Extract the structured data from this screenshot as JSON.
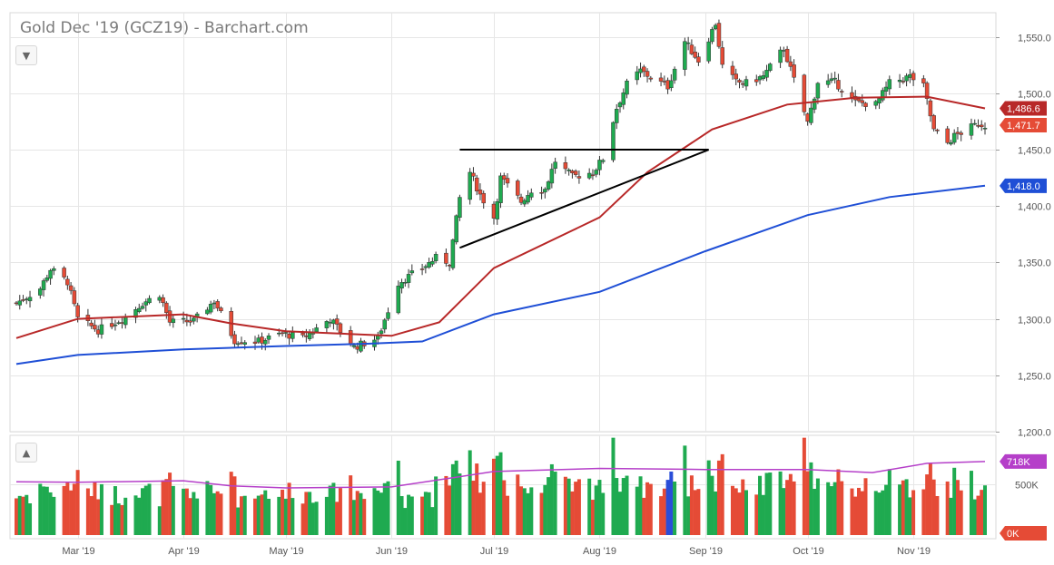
{
  "title": "Gold Dec '19 (GCZ19) - Barchart.com",
  "controls": {
    "collapse_main_icon": "chevron-down-icon",
    "collapse_volume_icon": "chevron-up-icon"
  },
  "colors": {
    "up": "#1faa50",
    "down": "#e54b36",
    "ma_slow": "#1f4fd6",
    "ma_fast": "#b82828",
    "vol_avg": "#b53fc9",
    "vol_special": "#2a4dd8",
    "trendline": "#000000",
    "grid": "#e6e6e6"
  },
  "chart_data": [
    {
      "type": "candlestick",
      "title": "Gold Dec '19 (GCZ19) - Barchart.com",
      "x_tick_labels": [
        "Mar '19",
        "Apr '19",
        "May '19",
        "Jun '19",
        "Jul '19",
        "Aug '19",
        "Sep '19",
        "Oct '19",
        "Nov '19"
      ],
      "y_tick_labels": [
        "1,550.0",
        "1,500.0",
        "1,450.0",
        "1,400.0",
        "1,350.0",
        "1,300.0",
        "1,250.0",
        "1,200.0"
      ],
      "ylim": [
        1200,
        1565
      ],
      "grid": true,
      "price_labels": [
        {
          "text": "1,486.6",
          "value": 1486.6,
          "series": "ma_fast"
        },
        {
          "text": "1,471.7",
          "value": 1471.7,
          "series": "last"
        },
        {
          "text": "1,418.0",
          "value": 1418.0,
          "series": "ma_slow"
        }
      ],
      "anchors": [
        [
          "2019-02-11",
          1314
        ],
        [
          "2019-02-18",
          1327
        ],
        [
          "2019-02-21",
          1344
        ],
        [
          "2019-02-26",
          1333
        ],
        [
          "2019-03-01",
          1300
        ],
        [
          "2019-03-07",
          1290
        ],
        [
          "2019-03-14",
          1300
        ],
        [
          "2019-03-20",
          1314
        ],
        [
          "2019-03-25",
          1322
        ],
        [
          "2019-03-28",
          1297
        ],
        [
          "2019-04-04",
          1298
        ],
        [
          "2019-04-10",
          1316
        ],
        [
          "2019-04-16",
          1281
        ],
        [
          "2019-04-23",
          1280
        ],
        [
          "2019-04-30",
          1287
        ],
        [
          "2019-05-06",
          1283
        ],
        [
          "2019-05-14",
          1300
        ],
        [
          "2019-05-21",
          1275
        ],
        [
          "2019-05-28",
          1283
        ],
        [
          "2019-06-03",
          1332
        ],
        [
          "2019-06-10",
          1345
        ],
        [
          "2019-06-14",
          1354
        ],
        [
          "2019-06-18",
          1350
        ],
        [
          "2019-06-21",
          1407
        ],
        [
          "2019-06-24",
          1430
        ],
        [
          "2019-06-27",
          1410
        ],
        [
          "2019-07-01",
          1390
        ],
        [
          "2019-07-03",
          1425
        ],
        [
          "2019-07-09",
          1404
        ],
        [
          "2019-07-12",
          1414
        ],
        [
          "2019-07-16",
          1415
        ],
        [
          "2019-07-19",
          1440
        ],
        [
          "2019-07-24",
          1426
        ],
        [
          "2019-07-30",
          1430
        ],
        [
          "2019-08-02",
          1442
        ],
        [
          "2019-08-06",
          1487
        ],
        [
          "2019-08-09",
          1508
        ],
        [
          "2019-08-13",
          1520
        ],
        [
          "2019-08-16",
          1514
        ],
        [
          "2019-08-21",
          1506
        ],
        [
          "2019-08-26",
          1546
        ],
        [
          "2019-08-30",
          1529
        ],
        [
          "2019-09-04",
          1562
        ],
        [
          "2019-09-06",
          1524
        ],
        [
          "2019-09-10",
          1510
        ],
        [
          "2019-09-13",
          1509
        ],
        [
          "2019-09-18",
          1515
        ],
        [
          "2019-09-24",
          1540
        ],
        [
          "2019-10-01",
          1474
        ],
        [
          "2019-10-04",
          1510
        ],
        [
          "2019-10-09",
          1510
        ],
        [
          "2019-10-15",
          1492
        ],
        [
          "2019-10-21",
          1490
        ],
        [
          "2019-10-25",
          1509
        ],
        [
          "2019-10-31",
          1515
        ],
        [
          "2019-11-04",
          1506
        ],
        [
          "2019-11-07",
          1467
        ],
        [
          "2019-11-11",
          1456
        ],
        [
          "2019-11-13",
          1462
        ],
        [
          "2019-11-20",
          1473
        ],
        [
          "2019-11-22",
          1471.7
        ]
      ],
      "ma_fast": [
        [
          "2019-02-11",
          1283
        ],
        [
          "2019-03-01",
          1300
        ],
        [
          "2019-04-01",
          1304
        ],
        [
          "2019-04-15",
          1296
        ],
        [
          "2019-05-01",
          1289
        ],
        [
          "2019-06-01",
          1285
        ],
        [
          "2019-06-15",
          1297
        ],
        [
          "2019-07-01",
          1345
        ],
        [
          "2019-08-01",
          1390
        ],
        [
          "2019-08-15",
          1430
        ],
        [
          "2019-09-03",
          1468
        ],
        [
          "2019-09-25",
          1490
        ],
        [
          "2019-10-15",
          1496
        ],
        [
          "2019-11-05",
          1497
        ],
        [
          "2019-11-22",
          1486.6
        ]
      ],
      "ma_slow": [
        [
          "2019-02-11",
          1260
        ],
        [
          "2019-03-01",
          1268
        ],
        [
          "2019-04-01",
          1273
        ],
        [
          "2019-05-01",
          1276
        ],
        [
          "2019-05-25",
          1278
        ],
        [
          "2019-06-10",
          1280
        ],
        [
          "2019-07-01",
          1304
        ],
        [
          "2019-08-01",
          1324
        ],
        [
          "2019-09-01",
          1360
        ],
        [
          "2019-10-01",
          1392
        ],
        [
          "2019-10-25",
          1408
        ],
        [
          "2019-11-22",
          1418.0
        ]
      ],
      "trendlines": [
        {
          "from": [
            "2019-06-21",
            1450
          ],
          "to": [
            "2019-09-02",
            1450
          ]
        },
        {
          "from": [
            "2019-06-21",
            1363
          ],
          "to": [
            "2019-09-02",
            1450
          ]
        }
      ]
    },
    {
      "type": "bar",
      "title": "",
      "y_tick_labels": [
        "500K",
        "0K"
      ],
      "ylim": [
        0,
        1000000
      ],
      "value_labels": [
        {
          "text": "718K",
          "value": 718000,
          "series": "vol_avg"
        }
      ],
      "volume_avg": [
        [
          "2019-02-11",
          520000
        ],
        [
          "2019-03-01",
          515000
        ],
        [
          "2019-04-01",
          530000
        ],
        [
          "2019-04-15",
          480000
        ],
        [
          "2019-05-01",
          460000
        ],
        [
          "2019-06-01",
          470000
        ],
        [
          "2019-06-15",
          540000
        ],
        [
          "2019-07-01",
          620000
        ],
        [
          "2019-08-01",
          650000
        ],
        [
          "2019-09-01",
          640000
        ],
        [
          "2019-10-01",
          640000
        ],
        [
          "2019-10-20",
          610000
        ],
        [
          "2019-11-05",
          700000
        ],
        [
          "2019-11-22",
          718000
        ]
      ]
    }
  ]
}
